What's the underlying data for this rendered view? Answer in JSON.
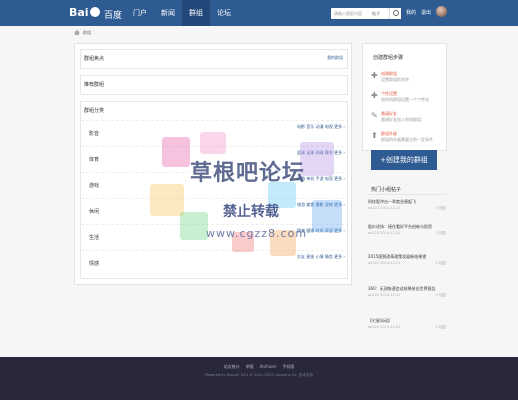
{
  "header": {
    "logo_text": "Bai",
    "logo_text2": "百度",
    "nav": [
      "门户",
      "新闻",
      "群组",
      "论坛"
    ],
    "search_placeholder": "请输入搜索内容",
    "search_type": "帖子",
    "user_links": [
      "我的",
      "退出"
    ],
    "accent_color": "#2e5b92"
  },
  "breadcrumb": {
    "current": "群组"
  },
  "main": {
    "hot_groups": {
      "title": "群组焦点",
      "more": "我的群组"
    },
    "recommended": {
      "title": "推荐群组"
    },
    "categories": {
      "title": "群组分类",
      "rows": [
        {
          "name": "影音",
          "tags": "电影 音乐 动漫 电视 更多 ›"
        },
        {
          "name": "体育",
          "tags": "篮球 足球 网球 赛车 更多 ›"
        },
        {
          "name": "游戏",
          "tags": "网游 单机 手游 电竞 更多 ›"
        },
        {
          "name": "休闲",
          "tags": "旅游 美食 摄影 宠物 更多 ›"
        },
        {
          "name": "生活",
          "tags": "情感 健康 时尚 家居 更多 ›"
        },
        {
          "name": "情感",
          "tags": "交友 星座 心情 婚恋 更多 ›"
        }
      ]
    }
  },
  "sidebar": {
    "title": "创建群组步骤",
    "steps": [
      {
        "icon": "plus-icon",
        "title": "创建群组",
        "desc": "设置群组的名称"
      },
      {
        "icon": "plus-icon",
        "title": "个性设置",
        "desc": "给你的群组设置一个个性化"
      },
      {
        "icon": "pencil-icon",
        "title": "邀请好友",
        "desc": "邀请好友加入你的群组"
      },
      {
        "icon": "arrow-up-icon",
        "title": "群组升级",
        "desc": "群组的升级需要达到一定条件"
      }
    ],
    "create_button": "+创建我的群组",
    "hot_title": "热门小组帖子",
    "hot_posts": [
      {
        "title": "科技股冲击一季度业绩起飞",
        "author": "an222",
        "date": "2014-12-21",
        "replies": "0 回复"
      },
      {
        "title": "股价进场：接住看好平台创新与投资",
        "author": "an222",
        "date": "2014-12-21",
        "replies": "0 回复"
      },
      {
        "title": "2015国税改革政策发展新结果望",
        "author": "an222",
        "date": "2014-12-21",
        "replies": "0 回复"
      },
      {
        "title": "360：无测恢速会议结果给出世界报告",
        "author": "an222",
        "date": "2014-12-21",
        "replies": "0 回复"
      },
      {
        "title": "【七星风动】",
        "author": "an222",
        "date": "2014-12-21",
        "replies": "0 回复"
      }
    ]
  },
  "watermark": {
    "line1": "草根吧论坛",
    "line2": "禁止转载",
    "line3": "www.cgzz8.com"
  },
  "footer": {
    "links": [
      "站点统计",
      "举报",
      "Archiver",
      "手机版"
    ],
    "copyright": "Powered by Discuz! X3.2   © 2001-2013 Comsenz Inc.   技术支持"
  }
}
